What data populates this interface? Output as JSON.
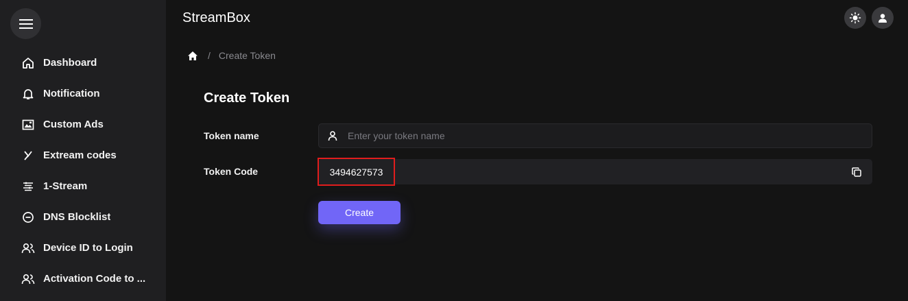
{
  "app": {
    "title": "StreamBox"
  },
  "sidebar": {
    "items": [
      {
        "label": "Dashboard",
        "icon": "home-icon"
      },
      {
        "label": "Notification",
        "icon": "bell-icon"
      },
      {
        "label": "Custom Ads",
        "icon": "ad-icon"
      },
      {
        "label": "Extream codes",
        "icon": "x-icon"
      },
      {
        "label": "1-Stream",
        "icon": "stream-icon"
      },
      {
        "label": "DNS Blocklist",
        "icon": "minus-circle-icon"
      },
      {
        "label": "Device ID to Login",
        "icon": "users-icon"
      },
      {
        "label": "Activation Code to ...",
        "icon": "users-icon"
      }
    ]
  },
  "breadcrumb": {
    "separator": "/",
    "current": "Create Token"
  },
  "form": {
    "title": "Create Token",
    "token_name_label": "Token name",
    "token_name_placeholder": "Enter your token name",
    "token_name_value": "",
    "token_code_label": "Token Code",
    "token_code_value": "3494627573",
    "submit_label": "Create"
  },
  "colors": {
    "accent": "#7166f7",
    "highlight": "#e11d1d",
    "sidebar_bg": "#1f1f21",
    "page_bg": "#141414"
  }
}
